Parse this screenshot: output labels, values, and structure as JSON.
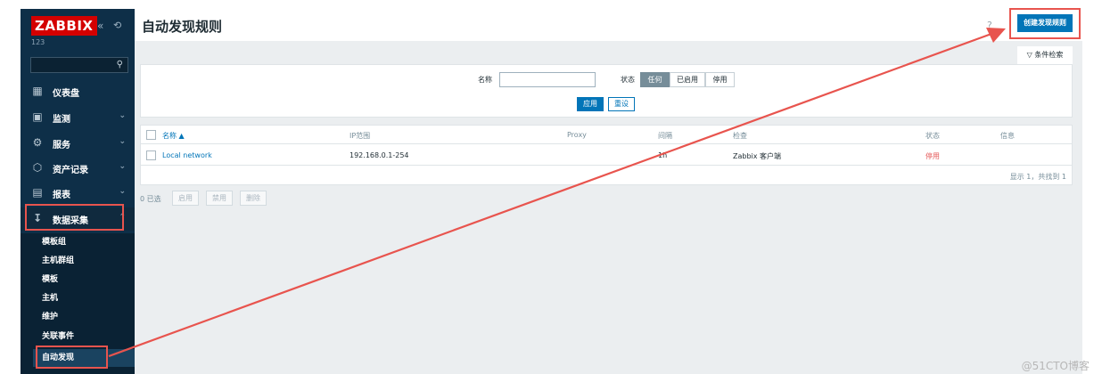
{
  "brand": {
    "logo_text": "ZABBIX",
    "server_name": "123",
    "collapse_glyph": "«",
    "kiosk_glyph": "⟲"
  },
  "sidebar": {
    "search_placeholder": "",
    "items": [
      {
        "label": "仪表盘",
        "icon": "dashboard-icon"
      },
      {
        "label": "监测",
        "icon": "monitoring-icon"
      },
      {
        "label": "服务",
        "icon": "services-icon"
      },
      {
        "label": "资产记录",
        "icon": "inventory-icon"
      },
      {
        "label": "报表",
        "icon": "reports-icon"
      },
      {
        "label": "数据采集",
        "icon": "data-collection-icon"
      }
    ],
    "submenu": [
      {
        "label": "模板组"
      },
      {
        "label": "主机群组"
      },
      {
        "label": "模板"
      },
      {
        "label": "主机"
      },
      {
        "label": "维护"
      },
      {
        "label": "关联事件"
      },
      {
        "label": "自动发现",
        "active": true
      }
    ]
  },
  "header": {
    "title": "自动发现规则",
    "help": "?",
    "create_button": "创建发现规则"
  },
  "filter": {
    "tab_label": "条件检索",
    "name_label": "名称",
    "name_value": "",
    "status_label": "状态",
    "status_options": [
      "任何",
      "已启用",
      "停用"
    ],
    "status_selected": "任何",
    "apply": "应用",
    "reset": "重设"
  },
  "table": {
    "columns": [
      "名称 ▲",
      "IP范围",
      "Proxy",
      "间隔",
      "检查",
      "状态",
      "信息"
    ],
    "rows": [
      {
        "name": "Local network",
        "ip_range": "192.168.0.1-254",
        "proxy": "",
        "interval": "1h",
        "checks": "Zabbix 客户端",
        "status": "停用",
        "info": ""
      }
    ],
    "pagination": "显示 1，共找到 1"
  },
  "mass_actions": {
    "selected": "0 已选",
    "buttons": [
      "启用",
      "禁用",
      "删除"
    ]
  },
  "watermark": "@51CTO博客",
  "colors": {
    "sidebar_bg": "#0e2f48",
    "accent": "#0275b8",
    "disabled_status": "#e45959",
    "logo_red": "#d40000",
    "annotation_red": "#e8544e"
  }
}
